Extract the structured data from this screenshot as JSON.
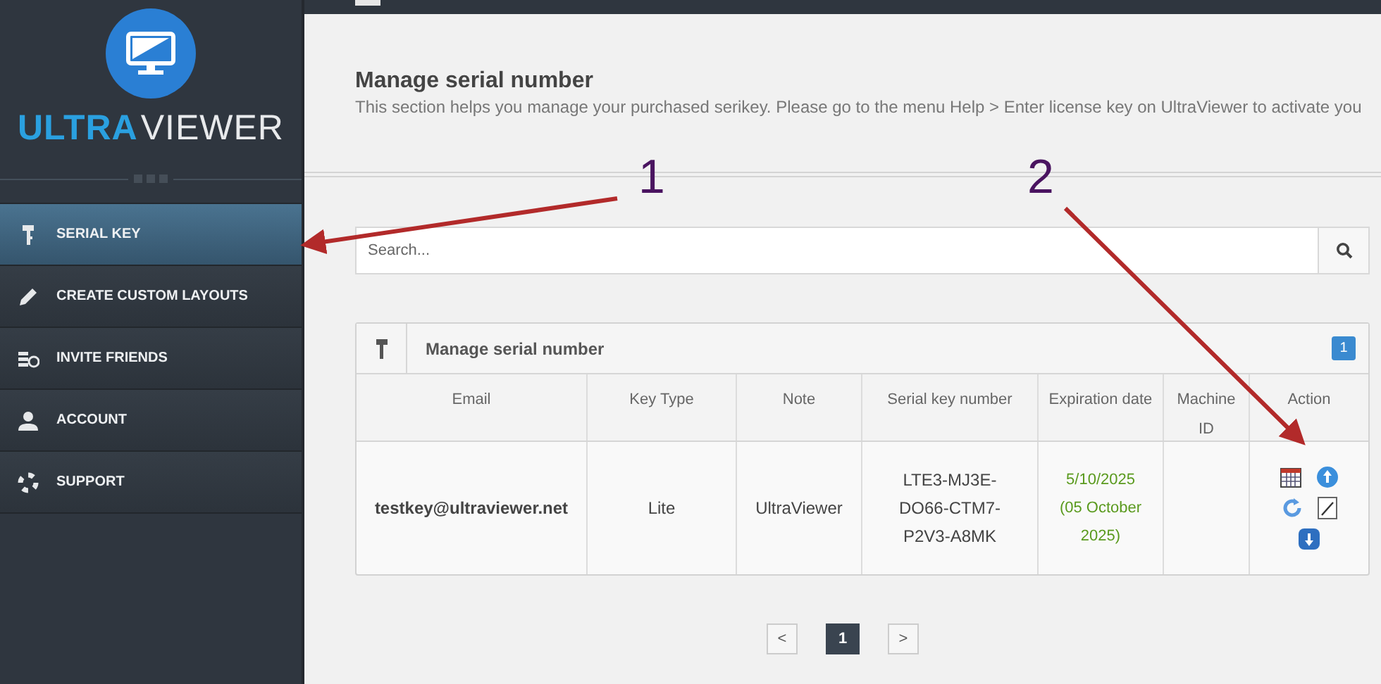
{
  "sidebar": {
    "logo": {
      "first": "ULTRA",
      "second": "VIEWER"
    },
    "items": [
      {
        "label": "SERIAL KEY",
        "kind": "key",
        "selected": true
      },
      {
        "label": "CREATE CUSTOM LAYOUTS",
        "kind": "pencil",
        "selected": false
      },
      {
        "label": "INVITE FRIENDS",
        "kind": "coins",
        "selected": false
      },
      {
        "label": "ACCOUNT",
        "kind": "user",
        "selected": false
      },
      {
        "label": "SUPPORT",
        "kind": "lifebuoy",
        "selected": false
      }
    ]
  },
  "header": {
    "title": "Manage serial number",
    "description": "This section helps you manage your purchased serikey. Please go to the menu Help > Enter license key on UltraViewer to activate you"
  },
  "search": {
    "placeholder": "Search..."
  },
  "panel": {
    "title": "Manage serial number",
    "count": "1",
    "table": {
      "columns": [
        "Email",
        "Key Type",
        "Note",
        "Serial key number",
        "Expiration date",
        "Machine ID",
        "Action"
      ],
      "rows": [
        {
          "email": "testkey@ultraviewer.net",
          "key_type": "Lite",
          "note": "UltraViewer",
          "serial": "LTE3-MJ3E-DO66-CTM7-P2V3-A8MK",
          "expiration": "5/10/2025",
          "expiration_long": "(05 October 2025)"
        }
      ]
    }
  },
  "pagination": {
    "prev": "<",
    "next": ">",
    "pages": [
      {
        "label": "1",
        "selected": true
      }
    ]
  },
  "annotations": [
    {
      "label": "1"
    },
    {
      "label": "2"
    }
  ]
}
